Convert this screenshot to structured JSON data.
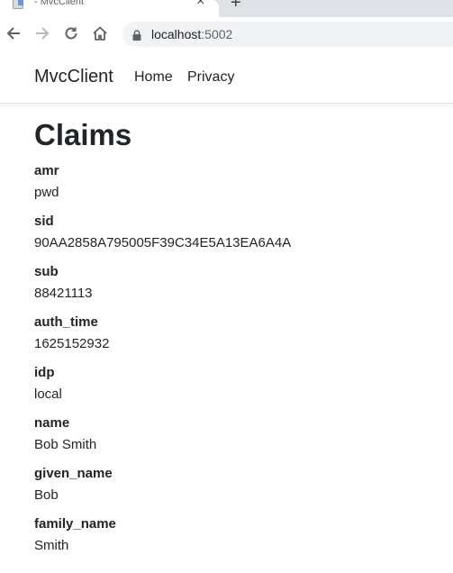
{
  "browser": {
    "tab_title": "- MvcClient",
    "url_host": "localhost",
    "url_port": ":5002",
    "icons": {
      "close": "close-icon",
      "new_tab": "plus-icon",
      "back": "arrow-left-icon",
      "forward": "arrow-right-icon",
      "reload": "reload-icon",
      "home": "home-icon",
      "lock": "lock-icon"
    }
  },
  "navbar": {
    "brand": "MvcClient",
    "links": [
      "Home",
      "Privacy"
    ]
  },
  "main": {
    "title": "Claims",
    "claims": [
      {
        "type": "amr",
        "value": "pwd"
      },
      {
        "type": "sid",
        "value": "90AA2858A795005F39C34E5A13EA6A4A"
      },
      {
        "type": "sub",
        "value": "88421113"
      },
      {
        "type": "auth_time",
        "value": "1625152932"
      },
      {
        "type": "idp",
        "value": "local"
      },
      {
        "type": "name",
        "value": "Bob Smith"
      },
      {
        "type": "given_name",
        "value": "Bob"
      },
      {
        "type": "family_name",
        "value": "Smith"
      }
    ]
  }
}
